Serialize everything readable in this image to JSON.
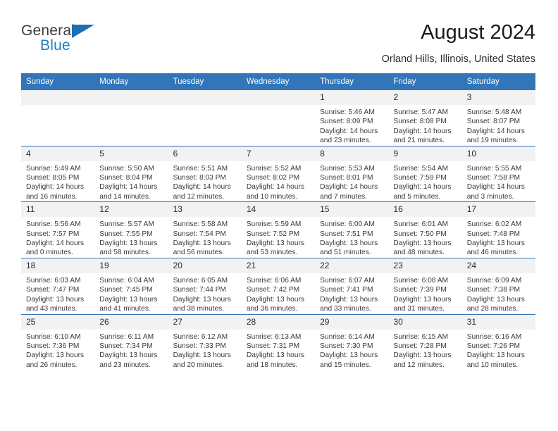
{
  "brand": {
    "name_top": "General",
    "name_bottom": "Blue",
    "flag_icon": "triangle-flag-icon",
    "color_top": "#3c3c3c",
    "color_bottom": "#1d7ec8",
    "flag_color": "#1a6fb5"
  },
  "header": {
    "title": "August 2024",
    "location": "Orland Hills, Illinois, United States"
  },
  "theme": {
    "header_blue": "#3275b8",
    "daynum_band": "#f2f2f2",
    "text": "#3a3a3a"
  },
  "weekday_headers": [
    "Sunday",
    "Monday",
    "Tuesday",
    "Wednesday",
    "Thursday",
    "Friday",
    "Saturday"
  ],
  "weeks": [
    [
      {
        "day": "",
        "details": ""
      },
      {
        "day": "",
        "details": ""
      },
      {
        "day": "",
        "details": ""
      },
      {
        "day": "",
        "details": ""
      },
      {
        "day": "1",
        "details": "Sunrise: 5:46 AM\nSunset: 8:09 PM\nDaylight: 14 hours\nand 23 minutes."
      },
      {
        "day": "2",
        "details": "Sunrise: 5:47 AM\nSunset: 8:08 PM\nDaylight: 14 hours\nand 21 minutes."
      },
      {
        "day": "3",
        "details": "Sunrise: 5:48 AM\nSunset: 8:07 PM\nDaylight: 14 hours\nand 19 minutes."
      }
    ],
    [
      {
        "day": "4",
        "details": "Sunrise: 5:49 AM\nSunset: 8:05 PM\nDaylight: 14 hours\nand 16 minutes."
      },
      {
        "day": "5",
        "details": "Sunrise: 5:50 AM\nSunset: 8:04 PM\nDaylight: 14 hours\nand 14 minutes."
      },
      {
        "day": "6",
        "details": "Sunrise: 5:51 AM\nSunset: 8:03 PM\nDaylight: 14 hours\nand 12 minutes."
      },
      {
        "day": "7",
        "details": "Sunrise: 5:52 AM\nSunset: 8:02 PM\nDaylight: 14 hours\nand 10 minutes."
      },
      {
        "day": "8",
        "details": "Sunrise: 5:53 AM\nSunset: 8:01 PM\nDaylight: 14 hours\nand 7 minutes."
      },
      {
        "day": "9",
        "details": "Sunrise: 5:54 AM\nSunset: 7:59 PM\nDaylight: 14 hours\nand 5 minutes."
      },
      {
        "day": "10",
        "details": "Sunrise: 5:55 AM\nSunset: 7:58 PM\nDaylight: 14 hours\nand 3 minutes."
      }
    ],
    [
      {
        "day": "11",
        "details": "Sunrise: 5:56 AM\nSunset: 7:57 PM\nDaylight: 14 hours\nand 0 minutes."
      },
      {
        "day": "12",
        "details": "Sunrise: 5:57 AM\nSunset: 7:55 PM\nDaylight: 13 hours\nand 58 minutes."
      },
      {
        "day": "13",
        "details": "Sunrise: 5:58 AM\nSunset: 7:54 PM\nDaylight: 13 hours\nand 56 minutes."
      },
      {
        "day": "14",
        "details": "Sunrise: 5:59 AM\nSunset: 7:52 PM\nDaylight: 13 hours\nand 53 minutes."
      },
      {
        "day": "15",
        "details": "Sunrise: 6:00 AM\nSunset: 7:51 PM\nDaylight: 13 hours\nand 51 minutes."
      },
      {
        "day": "16",
        "details": "Sunrise: 6:01 AM\nSunset: 7:50 PM\nDaylight: 13 hours\nand 48 minutes."
      },
      {
        "day": "17",
        "details": "Sunrise: 6:02 AM\nSunset: 7:48 PM\nDaylight: 13 hours\nand 46 minutes."
      }
    ],
    [
      {
        "day": "18",
        "details": "Sunrise: 6:03 AM\nSunset: 7:47 PM\nDaylight: 13 hours\nand 43 minutes."
      },
      {
        "day": "19",
        "details": "Sunrise: 6:04 AM\nSunset: 7:45 PM\nDaylight: 13 hours\nand 41 minutes."
      },
      {
        "day": "20",
        "details": "Sunrise: 6:05 AM\nSunset: 7:44 PM\nDaylight: 13 hours\nand 38 minutes."
      },
      {
        "day": "21",
        "details": "Sunrise: 6:06 AM\nSunset: 7:42 PM\nDaylight: 13 hours\nand 36 minutes."
      },
      {
        "day": "22",
        "details": "Sunrise: 6:07 AM\nSunset: 7:41 PM\nDaylight: 13 hours\nand 33 minutes."
      },
      {
        "day": "23",
        "details": "Sunrise: 6:08 AM\nSunset: 7:39 PM\nDaylight: 13 hours\nand 31 minutes."
      },
      {
        "day": "24",
        "details": "Sunrise: 6:09 AM\nSunset: 7:38 PM\nDaylight: 13 hours\nand 28 minutes."
      }
    ],
    [
      {
        "day": "25",
        "details": "Sunrise: 6:10 AM\nSunset: 7:36 PM\nDaylight: 13 hours\nand 26 minutes."
      },
      {
        "day": "26",
        "details": "Sunrise: 6:11 AM\nSunset: 7:34 PM\nDaylight: 13 hours\nand 23 minutes."
      },
      {
        "day": "27",
        "details": "Sunrise: 6:12 AM\nSunset: 7:33 PM\nDaylight: 13 hours\nand 20 minutes."
      },
      {
        "day": "28",
        "details": "Sunrise: 6:13 AM\nSunset: 7:31 PM\nDaylight: 13 hours\nand 18 minutes."
      },
      {
        "day": "29",
        "details": "Sunrise: 6:14 AM\nSunset: 7:30 PM\nDaylight: 13 hours\nand 15 minutes."
      },
      {
        "day": "30",
        "details": "Sunrise: 6:15 AM\nSunset: 7:28 PM\nDaylight: 13 hours\nand 12 minutes."
      },
      {
        "day": "31",
        "details": "Sunrise: 6:16 AM\nSunset: 7:26 PM\nDaylight: 13 hours\nand 10 minutes."
      }
    ]
  ]
}
